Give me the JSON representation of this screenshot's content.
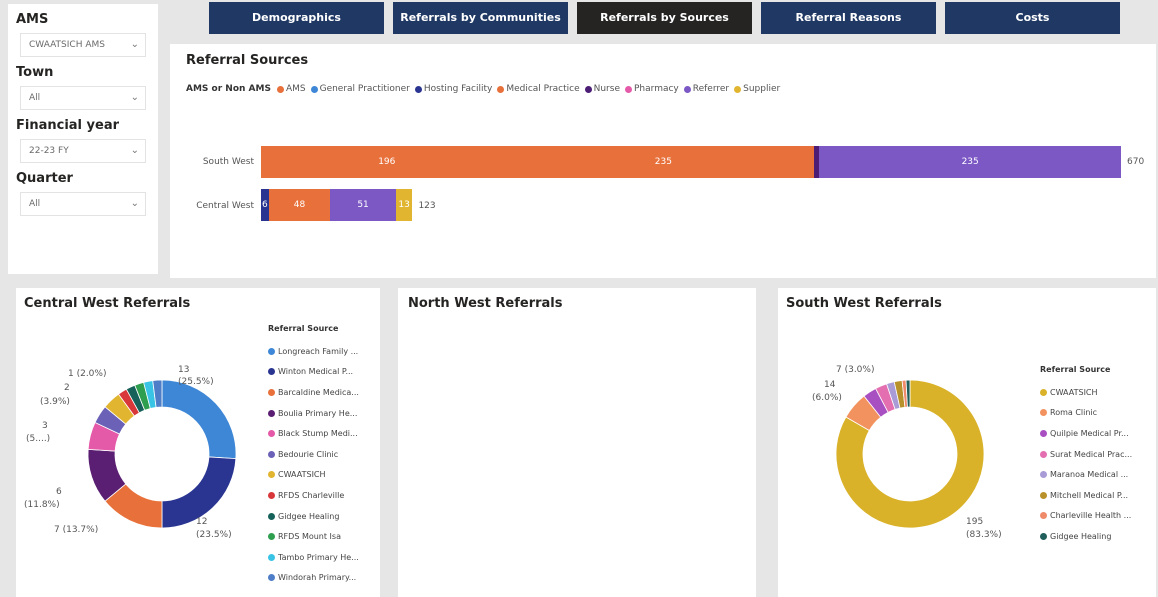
{
  "filters": {
    "ams_label": "AMS",
    "ams_value": "CWAATSICH AMS",
    "town_label": "Town",
    "town_value": "All",
    "fy_label": "Financial year",
    "fy_value": "22-23 FY",
    "quarter_label": "Quarter",
    "quarter_value": "All"
  },
  "tabs": [
    {
      "label": "Demographics",
      "active": false
    },
    {
      "label": "Referrals by Communities",
      "active": false
    },
    {
      "label": "Referrals by Sources",
      "active": true
    },
    {
      "label": "Referral Reasons",
      "active": false
    },
    {
      "label": "Costs",
      "active": false
    }
  ],
  "colors": {
    "tab": "#1f3864",
    "tab_active": "#252423",
    "AMS": "#e8703a",
    "General Practitioner": "#3e87d6",
    "Hosting Facility": "#2a3591",
    "Medical Practice": "#e8703a",
    "Nurse": "#4b1d74",
    "Pharmacy": "#e45aa9",
    "Referrer": "#7c58c5",
    "Supplier": "#e1b530"
  },
  "sources": {
    "title": "Referral Sources",
    "legend_title": "AMS or Non AMS",
    "legend": [
      "AMS",
      "General Practitioner",
      "Hosting Facility",
      "Medical Practice",
      "Nurse",
      "Pharmacy",
      "Referrer",
      "Supplier"
    ]
  },
  "chart_data": [
    {
      "type": "bar",
      "orientation": "horizontal",
      "stacked": true,
      "title": "Referral Sources",
      "legend_title": "AMS or Non AMS",
      "categories": [
        "South West",
        "Central West"
      ],
      "series": [
        {
          "name": "AMS",
          "values": [
            196,
            0
          ]
        },
        {
          "name": "Hosting Facility",
          "values": [
            0,
            6
          ]
        },
        {
          "name": "Medical Practice",
          "values": [
            235,
            48
          ]
        },
        {
          "name": "Nurse",
          "values": [
            4,
            0
          ]
        },
        {
          "name": "Referrer",
          "values": [
            235,
            51
          ]
        },
        {
          "name": "Supplier",
          "values": [
            0,
            13
          ]
        }
      ],
      "totals": [
        670,
        123
      ],
      "bar_labels": [
        [
          "196",
          "",
          "235",
          "",
          "235",
          ""
        ],
        [
          "",
          "6",
          "48",
          "",
          "51",
          "13"
        ]
      ],
      "xlim": [
        0,
        670
      ],
      "grid": false,
      "legend_position": "top-left"
    },
    {
      "type": "pie",
      "donut": true,
      "title": "Central West Referrals",
      "legend_title": "Referral Source",
      "labels": [
        "Longreach Family ...",
        "Winton Medical P...",
        "Barcaldine Medica...",
        "Boulia Primary He...",
        "Black Stump Medi...",
        "Bedourie Clinic",
        "CWAATSICH",
        "RFDS Charleville",
        "Gidgee Healing",
        "RFDS Mount Isa",
        "Tambo Primary He...",
        "Windorah Primary..."
      ],
      "values": [
        13,
        12,
        7,
        6,
        3,
        2,
        2,
        1,
        1,
        1,
        1,
        1
      ],
      "colors": [
        "#3e87d6",
        "#2a3591",
        "#e8703a",
        "#5a1f72",
        "#e45aa9",
        "#6b62b8",
        "#e1b530",
        "#d9383b",
        "#16625a",
        "#2e9e4f",
        "#39c4e6",
        "#4e7ec8"
      ],
      "data_labels": [
        {
          "text": "13",
          "sub": "(25.5%)"
        },
        {
          "text": "12",
          "sub": "(23.5%)"
        },
        {
          "text": "7 (13.7%)",
          "sub": ""
        },
        {
          "text": "6",
          "sub": "(11.8%)"
        },
        {
          "text": "3",
          "sub": "(5....)"
        },
        {
          "text": "2",
          "sub": "(3.9%)"
        },
        {
          "text": "1 (2.0%)",
          "sub": ""
        }
      ]
    },
    {
      "type": "pie",
      "donut": true,
      "title": "North West Referrals",
      "labels": [],
      "values": []
    },
    {
      "type": "pie",
      "donut": true,
      "title": "South West Referrals",
      "legend_title": "Referral Source",
      "labels": [
        "CWAATSICH",
        "Roma Clinic",
        "Quilpie Medical Pr...",
        "Surat Medical Prac...",
        "Maranoa Medical ...",
        "Mitchell Medical P...",
        "Charleville Health ...",
        "Gidgee Healing"
      ],
      "values": [
        195,
        14,
        7,
        6,
        4,
        4,
        2,
        2
      ],
      "colors": [
        "#d9b22a",
        "#f2925e",
        "#a84fc1",
        "#e46fb0",
        "#a89bd6",
        "#b8912a",
        "#ef8a6a",
        "#1f5e5a"
      ],
      "data_labels": [
        {
          "text": "195",
          "sub": "(83.3%)"
        },
        {
          "text": "14",
          "sub": "(6.0%)"
        },
        {
          "text": "7 (3.0%)",
          "sub": ""
        }
      ]
    }
  ]
}
